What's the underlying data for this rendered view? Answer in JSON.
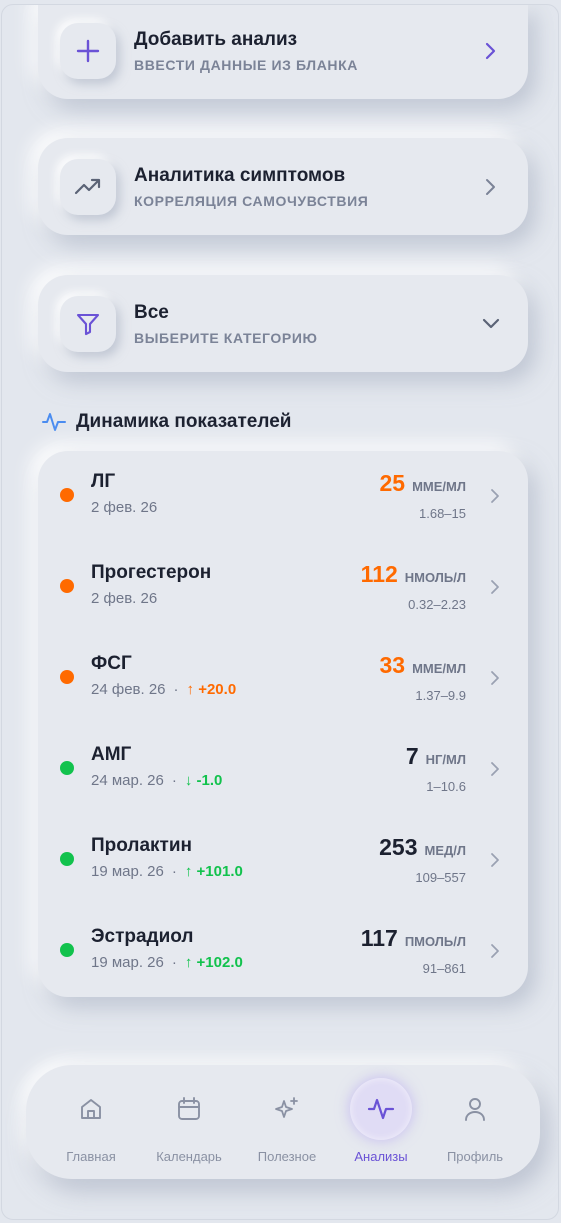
{
  "actions": [
    {
      "title": "Добавить анализ",
      "subtitle": "ВВЕСТИ ДАННЫЕ ИЗ БЛАНКА",
      "icon": "plus-icon"
    },
    {
      "title": "Аналитика симптомов",
      "subtitle": "КОРРЕЛЯЦИЯ САМОЧУВСТВИЯ",
      "icon": "trend-up-icon"
    },
    {
      "title": "Все",
      "subtitle": "ВЫБЕРИТЕ КАТЕГОРИЮ",
      "icon": "filter-icon"
    }
  ],
  "section": {
    "title": "Динамика показателей",
    "icon": "pulse-icon"
  },
  "results": [
    {
      "name": "ЛГ",
      "date": "2 фев. 26",
      "delta": "",
      "value": "25",
      "unit": "ММЕ/МЛ",
      "range": "1.68–15",
      "status": "out"
    },
    {
      "name": "Прогестерон",
      "date": "2 фев. 26",
      "delta": "",
      "value": "112",
      "unit": "НМОЛЬ/Л",
      "range": "0.32–2.23",
      "status": "out"
    },
    {
      "name": "ФСГ",
      "date": "24 фев. 26",
      "delta": "+20.0",
      "delta_dir": "up",
      "value": "33",
      "unit": "ММЕ/МЛ",
      "range": "1.37–9.9",
      "status": "out"
    },
    {
      "name": "АМГ",
      "date": "24 мар. 26",
      "delta": "-1.0",
      "delta_dir": "down",
      "value": "7",
      "unit": "НГ/МЛ",
      "range": "1–10.6",
      "status": "ok"
    },
    {
      "name": "Пролактин",
      "date": "19 мар. 26",
      "delta": "+101.0",
      "delta_dir": "up",
      "value": "253",
      "unit": "МЕД/Л",
      "range": "109–557",
      "status": "ok"
    },
    {
      "name": "Эстрадиол",
      "date": "19 мар. 26",
      "delta": "+102.0",
      "delta_dir": "up",
      "value": "117",
      "unit": "ПМОЛЬ/Л",
      "range": "91–861",
      "status": "ok"
    }
  ],
  "nav": [
    {
      "label": "Главная",
      "icon": "home-icon",
      "active": false
    },
    {
      "label": "Календарь",
      "icon": "calendar-icon",
      "active": false
    },
    {
      "label": "Полезное",
      "icon": "sparkles-icon",
      "active": false
    },
    {
      "label": "Анализы",
      "icon": "pulse-icon",
      "active": true
    },
    {
      "label": "Профиль",
      "icon": "user-icon",
      "active": false
    }
  ],
  "colors": {
    "accent": "#6a52d6",
    "out_of_range": "#ff6a00",
    "in_range": "#12c24d"
  }
}
